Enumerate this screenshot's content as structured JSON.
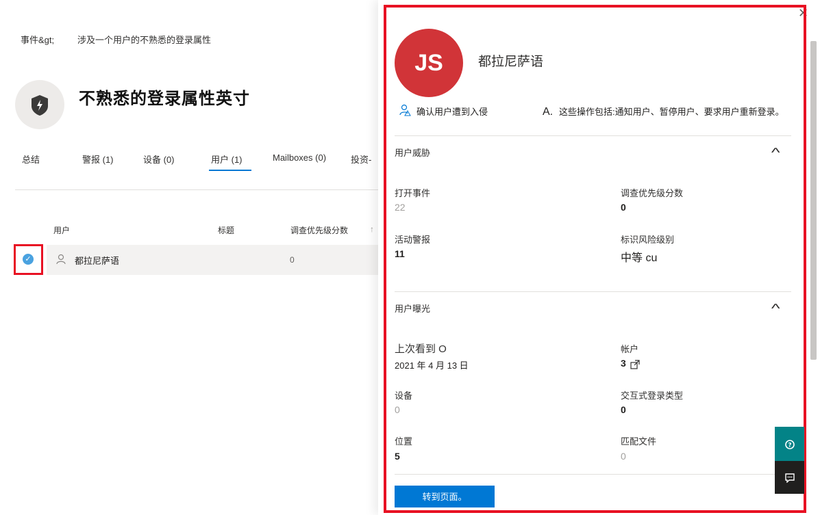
{
  "breadcrumb": {
    "root": "事件&gt;",
    "current": "涉及一个用户的不熟悉的登录属性"
  },
  "incident": {
    "title": "不熟悉的登录属性英寸"
  },
  "tabs": [
    {
      "label": "总结"
    },
    {
      "label": "警报 (1)"
    },
    {
      "label": "设备 (0)"
    },
    {
      "label": "用户 (1)"
    },
    {
      "label": "Mailboxes (0)"
    },
    {
      "label": "投资-"
    }
  ],
  "table": {
    "headers": {
      "user": "用户",
      "title": "标题",
      "score": "调查优先级分数"
    },
    "rows": [
      {
        "user": "都拉尼萨语",
        "title": "",
        "score": "0"
      }
    ]
  },
  "panel": {
    "avatar_initials": "JS",
    "user_name": "都拉尼萨语",
    "actions": {
      "confirm": "确认用户遭到入侵",
      "note_prefix": "A.",
      "note": "这些操作包括:通知用户、暂停用户、要求用户重新登录。"
    },
    "threat": {
      "title": "用户威胁",
      "open_incidents_label": "打开事件",
      "open_incidents_value": "22",
      "priority_label": "调查优先级分数",
      "priority_value": "0",
      "active_alerts_label": "活动警报",
      "active_alerts_value": "11",
      "risk_label": "标识风险级别",
      "risk_value": "中等 cu"
    },
    "exposure": {
      "title": "用户曝光",
      "last_seen_label": "上次看到 O",
      "last_seen_value": "2021 年 4 月 13 日",
      "accounts_label": "帐户",
      "accounts_value": "3",
      "devices_label": "设备",
      "devices_value": "0",
      "logon_label": "交互式登录类型",
      "logon_value": "0",
      "locations_label": "位置",
      "locations_value": "5",
      "profiles_label": "匹配文件",
      "profiles_value": "0"
    },
    "go_button": "转到页面。"
  },
  "colors": {
    "accent": "#0078d4",
    "avatar": "#d13438",
    "highlight": "#e81123",
    "help": "#038387"
  },
  "icons": [
    "shield-lightning-icon",
    "check-icon",
    "person-icon",
    "sort-arrow-icon",
    "confirm-user-icon",
    "chevron-up-icon",
    "open-external-icon",
    "close-icon",
    "help-icon",
    "feedback-icon"
  ]
}
